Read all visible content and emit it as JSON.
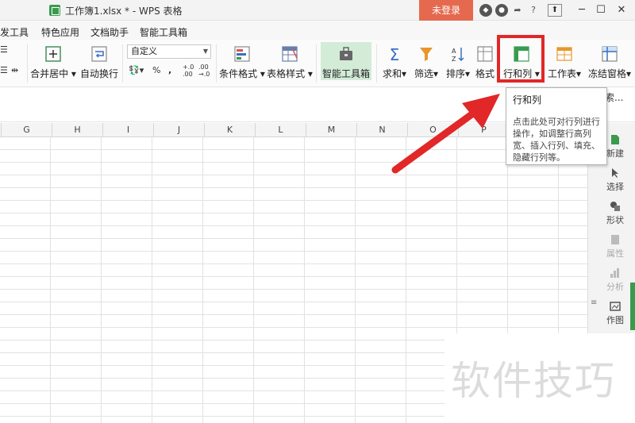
{
  "titlebar": {
    "title": "工作簿1.xlsx * - WPS 表格",
    "login_label": "未登录",
    "help_label": "?",
    "minimize": "─",
    "maximize": "☐",
    "close": "✕"
  },
  "menu": {
    "items": [
      {
        "label": "发工具"
      },
      {
        "label": "特色应用"
      },
      {
        "label": "文档助手"
      },
      {
        "label": "智能工具箱"
      }
    ]
  },
  "ribbon": {
    "merge_center": "合并居中",
    "wrap_text": "自动换行",
    "number_format": "自定义",
    "percent": "%",
    "comma": ",",
    "increase_decimal": "+.0\n.00",
    "decrease_decimal": ".00\n→.0",
    "conditional_format": "条件格式",
    "table_style": "表格样式",
    "smart_tools": "智能工具箱",
    "sum": "求和",
    "filter": "筛选",
    "sort": "排序",
    "format": "格式",
    "rows_cols": "行和列",
    "worksheet": "工作表",
    "freeze": "冻结窗格",
    "search_tail": "索..."
  },
  "tooltip": {
    "title": "行和列",
    "body": "点击此处可对行列进行操作，如调整行高列宽、插入行列、填充、隐藏行列等。"
  },
  "grid": {
    "columns": [
      "G",
      "H",
      "I",
      "J",
      "K",
      "L",
      "M",
      "N",
      "O",
      "P"
    ]
  },
  "side_panel": {
    "items": [
      {
        "label": "新建"
      },
      {
        "label": "选择"
      },
      {
        "label": "形状"
      },
      {
        "label": "属性"
      },
      {
        "label": "分析"
      },
      {
        "label": "作图"
      }
    ]
  },
  "watermark": "软件技巧",
  "colors": {
    "login_bg": "#e5694e",
    "highlight": "#e12727",
    "arrow": "#e12727",
    "smart_tools_bg": "#d3ecd8",
    "accent_green": "#3a9b4f"
  }
}
